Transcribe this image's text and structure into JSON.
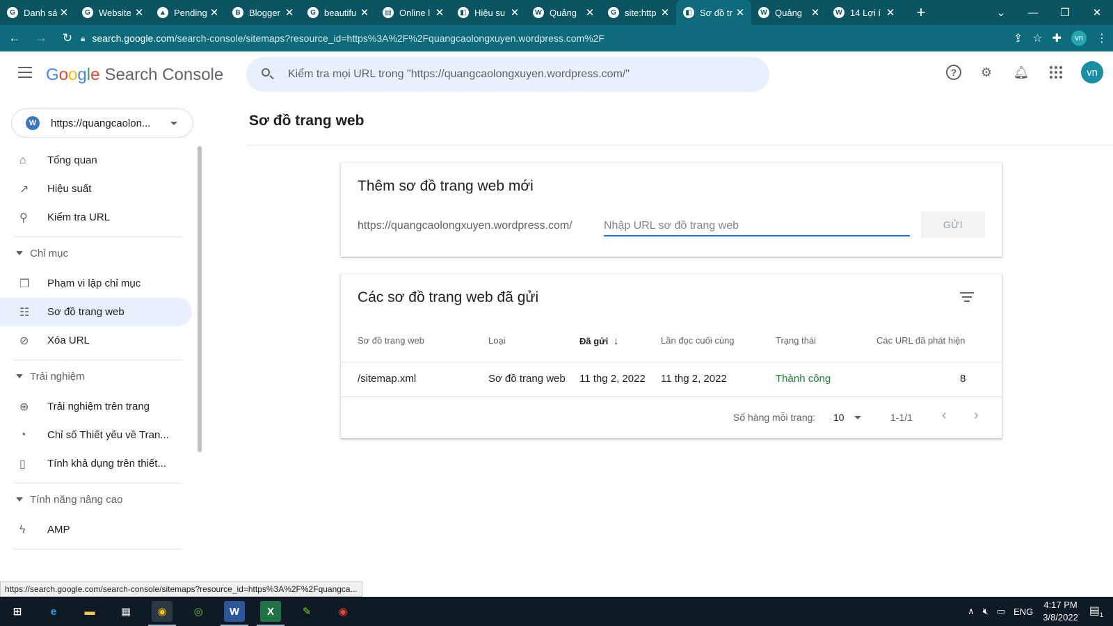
{
  "browser": {
    "tabs": [
      {
        "title": "Danh sá",
        "icon": "google-g-icon",
        "glyph": "G"
      },
      {
        "title": "Website",
        "icon": "google-g-icon",
        "glyph": "G"
      },
      {
        "title": "Pending",
        "icon": "google-drive-icon",
        "glyph": "▲"
      },
      {
        "title": "Blogger",
        "icon": "blogger-icon",
        "glyph": "B"
      },
      {
        "title": "beautifu",
        "icon": "google-g-icon",
        "glyph": "G"
      },
      {
        "title": "Online l",
        "icon": "document-icon",
        "glyph": "▤"
      },
      {
        "title": "Hiệu su",
        "icon": "search-console-icon",
        "glyph": "◧"
      },
      {
        "title": "Quảng",
        "icon": "wordpress-icon",
        "glyph": "W"
      },
      {
        "title": "site:http",
        "icon": "google-g-icon",
        "glyph": "G"
      },
      {
        "title": "Sơ đồ tr",
        "icon": "search-console-icon",
        "glyph": "◧",
        "active": true
      },
      {
        "title": "Quảng",
        "icon": "wordpress-icon",
        "glyph": "W"
      },
      {
        "title": "14 Lợi í",
        "icon": "wordpress-icon",
        "glyph": "W"
      }
    ],
    "url_host": "search.google.com",
    "url_path": "/search-console/sitemaps?resource_id=https%3A%2F%2Fquangcaolongxuyen.wordpress.com%2F",
    "profile_initials": "vn"
  },
  "header": {
    "logo_letters": [
      "G",
      "o",
      "o",
      "g",
      "l",
      "e"
    ],
    "product": "Search Console",
    "search_placeholder": "Kiểm tra mọi URL trong \"https://quangcaolongxuyen.wordpress.com/\"",
    "avatar_initials": "vn"
  },
  "sidebar": {
    "property_label": "https://quangcaolon...",
    "items_top": [
      {
        "label": "Tổng quan",
        "icon": "home-icon",
        "glyph": "⌂"
      },
      {
        "label": "Hiệu suất",
        "icon": "trending-up-icon",
        "glyph": "↗"
      },
      {
        "label": "Kiểm tra URL",
        "icon": "search-icon",
        "glyph": "⚲"
      }
    ],
    "section_index": "Chỉ mục",
    "items_index": [
      {
        "label": "Phạm vi lập chỉ mục",
        "icon": "copy-icon",
        "glyph": "❐"
      },
      {
        "label": "Sơ đồ trang web",
        "icon": "sitemap-icon",
        "glyph": "☷",
        "active": true
      },
      {
        "label": "Xóa URL",
        "icon": "visibility-off-icon",
        "glyph": "⊘"
      }
    ],
    "section_experience": "Trải nghiệm",
    "items_experience": [
      {
        "label": "Trải nghiệm trên trang",
        "icon": "add-circle-icon",
        "glyph": "⊕"
      },
      {
        "label": "Chỉ số Thiết yếu về Tran...",
        "icon": "speed-gauge-icon",
        "glyph": "◔"
      },
      {
        "label": "Tính khả dụng trên thiết...",
        "icon": "smartphone-icon",
        "glyph": "▯"
      }
    ],
    "section_advanced": "Tính năng nâng cao",
    "items_advanced": [
      {
        "label": "AMP",
        "icon": "bolt-icon",
        "glyph": "ϟ"
      }
    ]
  },
  "main": {
    "page_title": "Sơ đồ trang web",
    "add_card": {
      "title": "Thêm sơ đồ trang web mới",
      "prefix": "https://quangcaolongxuyen.wordpress.com/",
      "input_placeholder": "Nhập URL sơ đồ trang web",
      "input_value": "",
      "submit_label": "GỬI"
    },
    "list_card": {
      "title": "Các sơ đồ trang web đã gửi",
      "columns": [
        "Sơ đồ trang web",
        "Loại",
        "Đã gửi",
        "Lần đọc cuối cùng",
        "Trạng thái",
        "Các URL đã phát hiện"
      ],
      "sort_indicator": "↓",
      "rows": [
        {
          "sitemap": "/sitemap.xml",
          "type": "Sơ đồ trang web",
          "submitted": "11 thg 2, 2022",
          "last_read": "11 thg 2, 2022",
          "status": "Thành công",
          "urls": "8"
        }
      ],
      "rows_per_page_label": "Số hàng mỗi trang:",
      "rows_per_page": "10",
      "range": "1-1/1"
    }
  },
  "status_bar": {
    "hover_url": "https://search.google.com/search-console/sitemaps?resource_id=https%3A%2F%2Fquangca..."
  },
  "taskbar": {
    "lang": "ENG",
    "time": "4:17 PM",
    "date": "3/8/2022",
    "notification_count": "1"
  },
  "colors": {
    "browser_frame": "#0b5563",
    "accent_blue": "#1a73e8",
    "active_nav_bg": "#e8f0fe",
    "success_green": "#188038"
  }
}
